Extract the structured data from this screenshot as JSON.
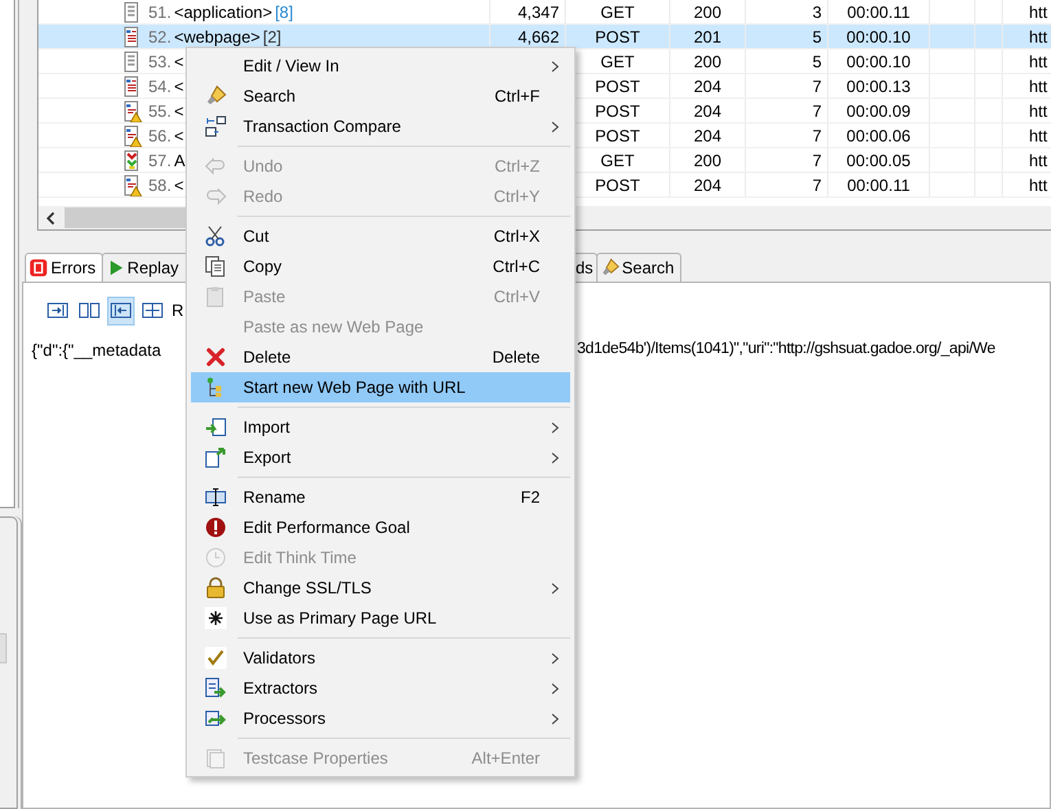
{
  "table": {
    "rows": [
      {
        "number": "51.",
        "name": "<application>",
        "badge": "[8]",
        "kind": "application",
        "selected": false,
        "size": "4,347",
        "method": "GET",
        "status": "200",
        "column_4": "3",
        "time": "00:00.11",
        "url": "htt"
      },
      {
        "number": "52.",
        "name": "<webpage>",
        "badge": "[2]",
        "kind": "webpage",
        "selected": true,
        "size": "4,662",
        "method": "POST",
        "status": "201",
        "column_4": "5",
        "time": "00:00.10",
        "url": "htt"
      },
      {
        "number": "53.",
        "name": "<",
        "kind": "application",
        "selected": false,
        "method": "GET",
        "status": "200",
        "column_4": "5",
        "time": "00:00.10",
        "url": "htt"
      },
      {
        "number": "54.",
        "name": "<",
        "kind": "webpage",
        "selected": false,
        "method": "POST",
        "status": "204",
        "column_4": "7",
        "time": "00:00.13",
        "url": "htt"
      },
      {
        "number": "55.",
        "name": "<",
        "kind": "webpage-warning",
        "selected": false,
        "method": "POST",
        "status": "204",
        "column_4": "7",
        "time": "00:00.09",
        "url": "htt"
      },
      {
        "number": "56.",
        "name": "<",
        "kind": "webpage-warning",
        "selected": false,
        "method": "POST",
        "status": "204",
        "column_4": "7",
        "time": "00:00.06",
        "url": "htt"
      },
      {
        "number": "57.",
        "name": "A",
        "kind": "action",
        "selected": false,
        "method": "GET",
        "status": "200",
        "column_4": "7",
        "time": "00:00.05",
        "url": "htt"
      },
      {
        "number": "58.",
        "name": "<",
        "kind": "webpage-warning",
        "selected": false,
        "method": "POST",
        "status": "204",
        "column_4": "7",
        "time": "00:00.11",
        "url": "htt"
      }
    ]
  },
  "bottom_panel": {
    "tabs": [
      {
        "label": "Errors",
        "kind": "errors",
        "selected": true
      },
      {
        "label": "Replay",
        "kind": "replay",
        "selected": false
      },
      {
        "label": "ds",
        "kind": "plain",
        "selected": false
      },
      {
        "label": "Search",
        "kind": "search",
        "selected": false
      }
    ],
    "toolbar": {
      "buttons": [
        {
          "selected": false
        },
        {
          "selected": false
        },
        {
          "selected": true
        },
        {
          "selected": false
        }
      ],
      "label": "R"
    },
    "content_left": "{\"d\":{\"__metadata",
    "content_right": "3d1de54b')/Items(1041)\",\"uri\":\"http://gshsuat.gadoe.org/_api/We"
  },
  "context_menu": {
    "items": [
      {
        "kind": "item",
        "label": "Edit / View In",
        "submenu": true,
        "disabled": false,
        "selected": false
      },
      {
        "kind": "item",
        "label": "Search",
        "shortcut": "Ctrl+F",
        "submenu": false,
        "disabled": false,
        "selected": false
      },
      {
        "kind": "item",
        "label": "Transaction Compare",
        "submenu": true,
        "disabled": false,
        "selected": false
      },
      {
        "kind": "separator"
      },
      {
        "kind": "item",
        "label": "Undo",
        "shortcut": "Ctrl+Z",
        "submenu": false,
        "disabled": true,
        "selected": false
      },
      {
        "kind": "item",
        "label": "Redo",
        "shortcut": "Ctrl+Y",
        "submenu": false,
        "disabled": true,
        "selected": false
      },
      {
        "kind": "separator"
      },
      {
        "kind": "item",
        "label": "Cut",
        "shortcut": "Ctrl+X",
        "submenu": false,
        "disabled": false,
        "selected": false
      },
      {
        "kind": "item",
        "label": "Copy",
        "shortcut": "Ctrl+C",
        "submenu": false,
        "disabled": false,
        "selected": false
      },
      {
        "kind": "item",
        "label": "Paste",
        "shortcut": "Ctrl+V",
        "submenu": false,
        "disabled": true,
        "selected": false
      },
      {
        "kind": "item",
        "label": "Paste as new Web Page",
        "submenu": false,
        "disabled": true,
        "selected": false
      },
      {
        "kind": "item",
        "label": "Delete",
        "shortcut": "Delete",
        "submenu": false,
        "disabled": false,
        "selected": false
      },
      {
        "kind": "item",
        "label": "Start new Web Page with URL",
        "submenu": false,
        "disabled": false,
        "selected": true
      },
      {
        "kind": "separator"
      },
      {
        "kind": "item",
        "label": "Import",
        "submenu": true,
        "disabled": false,
        "selected": false
      },
      {
        "kind": "item",
        "label": "Export",
        "submenu": true,
        "disabled": false,
        "selected": false
      },
      {
        "kind": "separator"
      },
      {
        "kind": "item",
        "label": "Rename",
        "shortcut": "F2",
        "submenu": false,
        "disabled": false,
        "selected": false
      },
      {
        "kind": "item",
        "label": "Edit Performance Goal",
        "submenu": false,
        "disabled": false,
        "selected": false
      },
      {
        "kind": "item",
        "label": "Edit Think Time",
        "submenu": false,
        "disabled": true,
        "selected": false
      },
      {
        "kind": "item",
        "label": "Change SSL/TLS",
        "submenu": true,
        "disabled": false,
        "selected": false
      },
      {
        "kind": "item",
        "label": "Use as Primary Page URL",
        "submenu": false,
        "disabled": false,
        "selected": false
      },
      {
        "kind": "separator"
      },
      {
        "kind": "item",
        "label": "Validators",
        "submenu": true,
        "disabled": false,
        "selected": false
      },
      {
        "kind": "item",
        "label": "Extractors",
        "submenu": true,
        "disabled": false,
        "selected": false
      },
      {
        "kind": "item",
        "label": "Processors",
        "submenu": true,
        "disabled": false,
        "selected": false
      },
      {
        "kind": "separator"
      },
      {
        "kind": "item",
        "label": "Testcase Properties",
        "shortcut": "Alt+Enter",
        "submenu": false,
        "disabled": true,
        "selected": false
      }
    ]
  }
}
